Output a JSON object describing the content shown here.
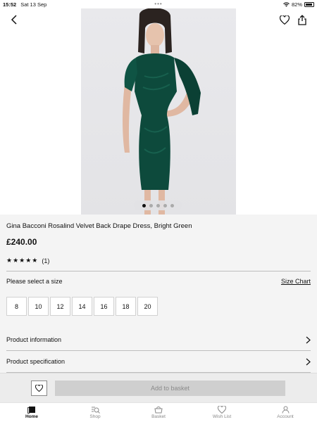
{
  "status_bar": {
    "time": "15:52",
    "date": "Sat 13 Sep",
    "battery": "82%"
  },
  "product": {
    "title": "Gina Bacconi Rosalind Velvet Back Drape Dress, Bright Green",
    "price": "£240.00",
    "stars": "★★★★★",
    "review_count": "(1)",
    "rating_value": 5,
    "dress_color": "#0d4a3c"
  },
  "carousel": {
    "total": 5,
    "active_index": 0
  },
  "size_section": {
    "label": "Please select a size",
    "chart_link": "Size Chart",
    "sizes": [
      "8",
      "10",
      "12",
      "14",
      "16",
      "18",
      "20"
    ]
  },
  "sections": {
    "product_information": "Product information",
    "product_specification": "Product specification"
  },
  "actions": {
    "add_to_basket": "Add to basket"
  },
  "tabs": [
    {
      "label": "Home",
      "icon": "home-icon",
      "active": true
    },
    {
      "label": "Shop",
      "icon": "shop-icon",
      "active": false
    },
    {
      "label": "Basket",
      "icon": "basket-icon",
      "active": false
    },
    {
      "label": "Wish List",
      "icon": "heart-icon",
      "active": false
    },
    {
      "label": "Account",
      "icon": "account-icon",
      "active": false
    }
  ]
}
